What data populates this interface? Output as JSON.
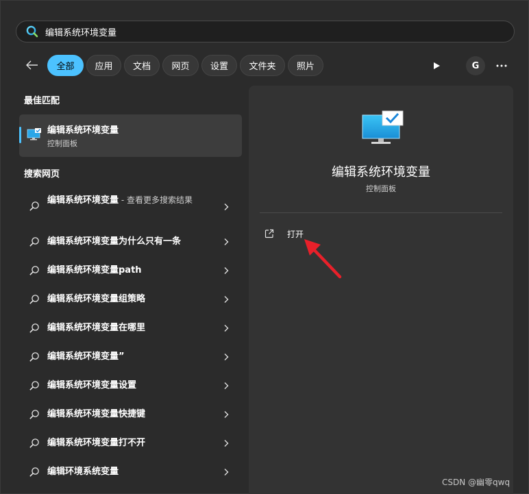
{
  "search": {
    "value": "编辑系统环境变量",
    "icon": "search-icon"
  },
  "filters": {
    "back_icon": "back-arrow-icon",
    "tabs": [
      {
        "label": "全部",
        "active": true
      },
      {
        "label": "应用",
        "active": false
      },
      {
        "label": "文档",
        "active": false
      },
      {
        "label": "网页",
        "active": false
      },
      {
        "label": "设置",
        "active": false
      },
      {
        "label": "文件夹",
        "active": false
      },
      {
        "label": "照片",
        "active": false
      }
    ],
    "play_icon": "play-icon",
    "account_letter": "G",
    "more_icon": "more-icon"
  },
  "best_match": {
    "section_label": "最佳匹配",
    "title": "编辑系统环境变量",
    "subtitle": "控制面板",
    "icon": "monitor-check-icon"
  },
  "web_search": {
    "section_label": "搜索网页",
    "items": [
      {
        "text": "编辑系统环境变量",
        "suffix": " - 查看更多搜索结果"
      },
      {
        "text": "编辑系统环境变量为什么只有一条"
      },
      {
        "text": "编辑系统环境变量path"
      },
      {
        "text": "编辑系统环境变量组策略"
      },
      {
        "text": "编辑系统环境变量在哪里"
      },
      {
        "text": "编辑系统环境变量”"
      },
      {
        "text": "编辑系统环境变量设置"
      },
      {
        "text": "编辑系统环境变量快捷键"
      },
      {
        "text": "编辑系统环境变量打不开"
      },
      {
        "text": "编辑环境系统变量"
      }
    ]
  },
  "preview": {
    "title": "编辑系统环境变量",
    "subtitle": "控制面板",
    "actions": [
      {
        "label": "打开",
        "icon": "open-external-icon"
      }
    ]
  },
  "watermark": "CSDN @幽零qwq",
  "colors": {
    "accent": "#4cc2ff",
    "background": "#2b2b2b",
    "panel": "#333333",
    "annotation": "#e8202a"
  }
}
